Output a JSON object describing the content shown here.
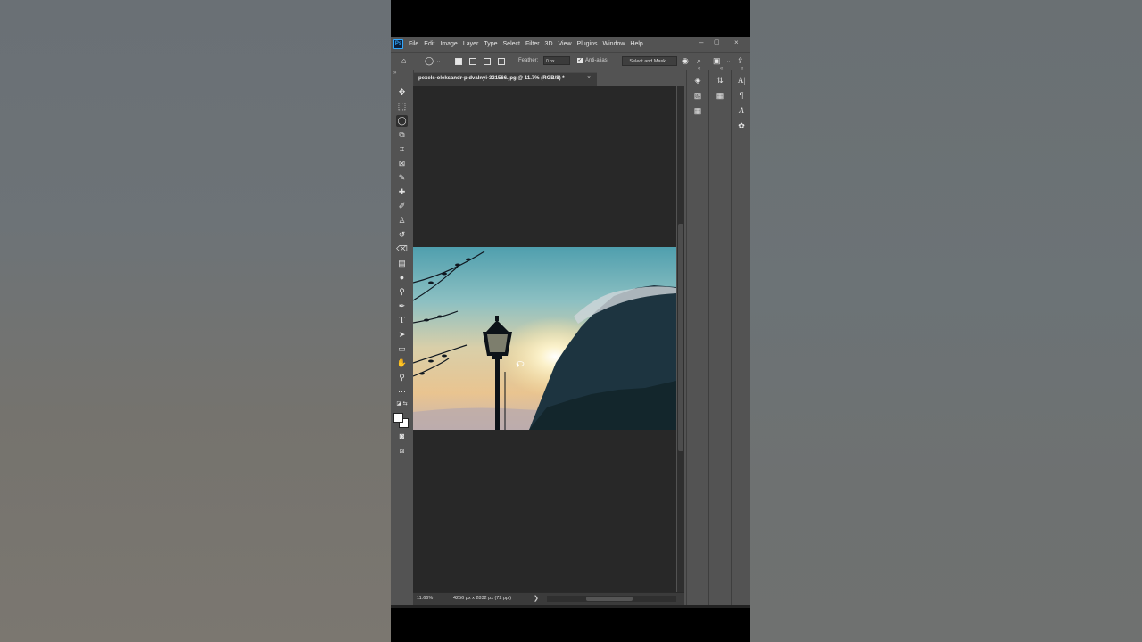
{
  "menubar": {
    "logo": "Ps",
    "items": [
      "File",
      "Edit",
      "Image",
      "Layer",
      "Type",
      "Select",
      "Filter",
      "3D",
      "View",
      "Plugins",
      "Window",
      "Help"
    ]
  },
  "window_controls": {
    "minimize": "–",
    "maximize": "▢",
    "close": "×"
  },
  "options_bar": {
    "home_icon": "home-icon",
    "lasso_icon": "lasso-icon",
    "feather_label": "Feather:",
    "feather_value": "0 px",
    "anti_alias_label": "Anti-alias",
    "anti_alias_checked": true,
    "select_and_mask_label": "Select and Mask..."
  },
  "document": {
    "tab_label": "pexels-oleksandr-pidvalnyi-321566.jpg @ 11.7% (RGB/8) *",
    "close_glyph": "×"
  },
  "status_bar": {
    "zoom": "11.66%",
    "doc_info": "4256 px x 2832 px (72 ppi)",
    "arrow": "❯"
  },
  "toolbar": {
    "tools": [
      "move-tool",
      "marquee-tool",
      "lasso-tool",
      "object-select-tool",
      "crop-tool",
      "frame-tool",
      "eyedropper-tool",
      "healing-brush-tool",
      "brush-tool",
      "clone-stamp-tool",
      "history-brush-tool",
      "eraser-tool",
      "gradient-tool",
      "blur-tool",
      "dodge-tool",
      "pen-tool",
      "type-tool",
      "path-selection-tool",
      "rectangle-tool",
      "hand-tool",
      "zoom-tool",
      "more-tools",
      "default-colors",
      "foreground-color",
      "quick-mask",
      "screen-mode"
    ],
    "active": "lasso-tool"
  },
  "colors": {
    "app_bg": "#535353",
    "canvas_bg": "#282828",
    "foreground": "#ffffff",
    "background": "#ffffff"
  }
}
